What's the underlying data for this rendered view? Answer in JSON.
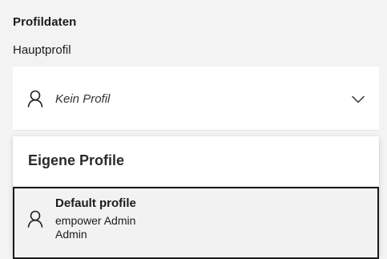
{
  "section": {
    "title": "Profildaten"
  },
  "main_profile": {
    "label": "Hauptprofil",
    "selected_value": "Kein Profil",
    "icon": "person-icon",
    "dropdown_icon": "chevron-down-icon"
  },
  "popup": {
    "header": "Eigene Profile",
    "items": [
      {
        "name": "Default profile",
        "line2": "empower Admin",
        "line3": "Admin",
        "icon": "person-icon",
        "selected": true
      }
    ]
  }
}
